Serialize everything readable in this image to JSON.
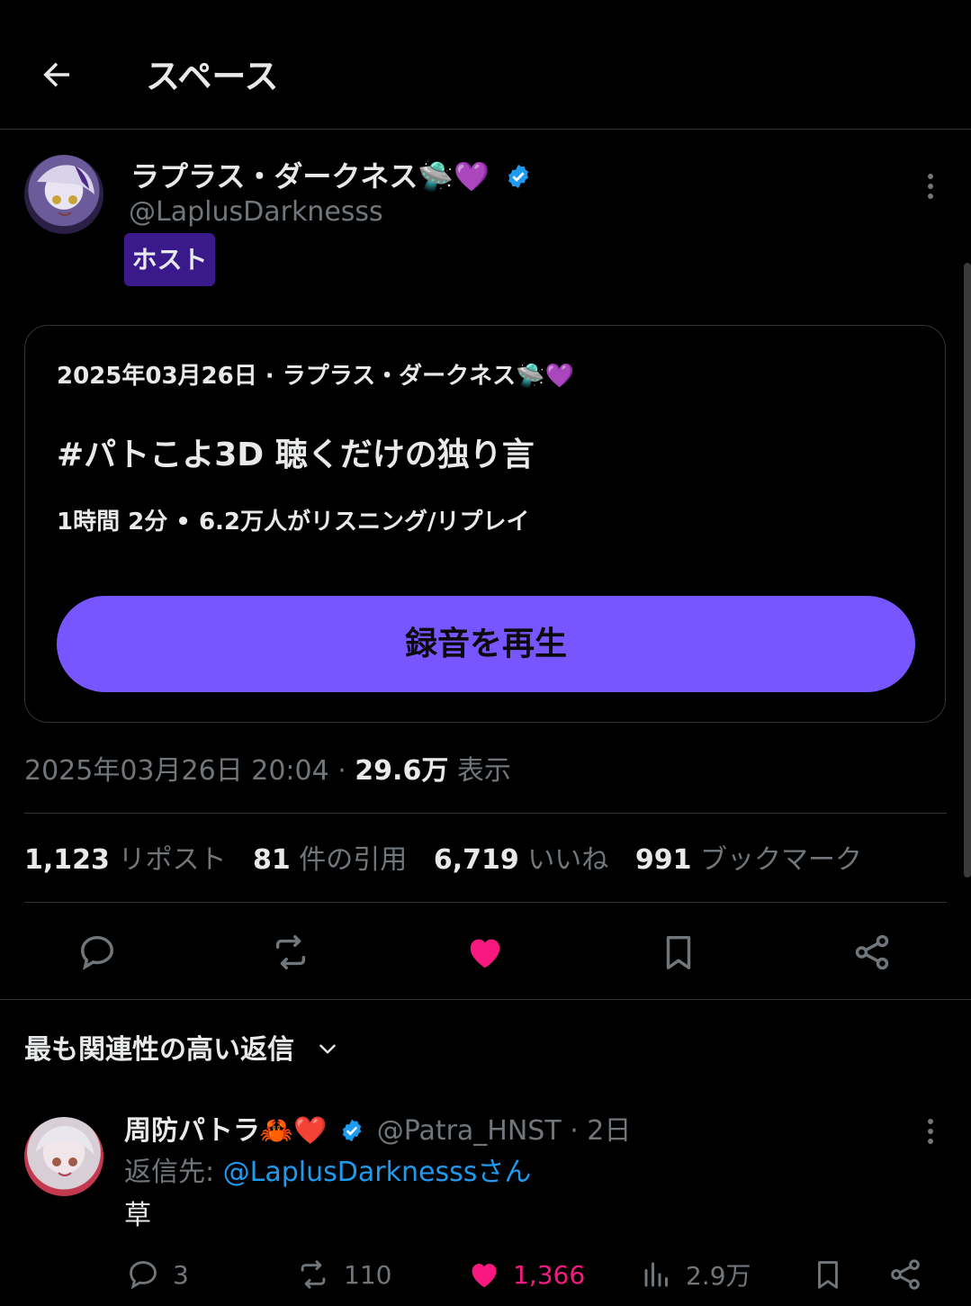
{
  "header": {
    "title": "スペース"
  },
  "host": {
    "display_name": "ラプラス・ダークネス🛸💜",
    "handle": "@LaplusDarknesss",
    "badge": "ホスト"
  },
  "space": {
    "meta": "2025年03月26日 · ラプラス・ダークネス🛸💜",
    "title": "#パトこよ3D 聴くだけの独り言",
    "stats": "1時間 2分 • 6.2万人がリスニング/リプレイ",
    "play_label": "録音を再生"
  },
  "post_meta": {
    "datetime": "2025年03月26日 20:04 · ",
    "views_count": "29.6万",
    "views_label": " 表示"
  },
  "engagement": {
    "reposts_count": "1,123",
    "reposts_label": " リポスト",
    "quotes_count": "81",
    "quotes_label": " 件の引用",
    "likes_count": "6,719",
    "likes_label": " いいね",
    "bookmarks_count": "991",
    "bookmarks_label": " ブックマーク"
  },
  "replies_sort": {
    "label": "最も関連性の高い返信"
  },
  "reply": {
    "display_name": "周防パトラ🦀❤️",
    "handle_time": "@Patra_HNST · 2日",
    "reply_to_prefix": "返信先: ",
    "reply_to_handle": "@LaplusDarknesssさん",
    "text": "草",
    "reply_count": "3",
    "repost_count": "110",
    "like_count": "1,366",
    "views_count": "2.9万"
  },
  "colors": {
    "accent": "#7856ff",
    "like": "#f91880",
    "link": "#1d9bf0",
    "verified": "#1d9bf0",
    "muted": "#71767b",
    "badge_bg": "#3a1a8a"
  },
  "icons": {
    "back": "arrow-left-icon",
    "more": "more-vertical-icon",
    "verified": "verified-badge-icon",
    "reply": "reply-icon",
    "repost": "repost-icon",
    "like": "heart-filled-icon",
    "bookmark": "bookmark-icon",
    "share": "share-icon",
    "views": "views-icon",
    "chevron": "chevron-down-icon"
  }
}
